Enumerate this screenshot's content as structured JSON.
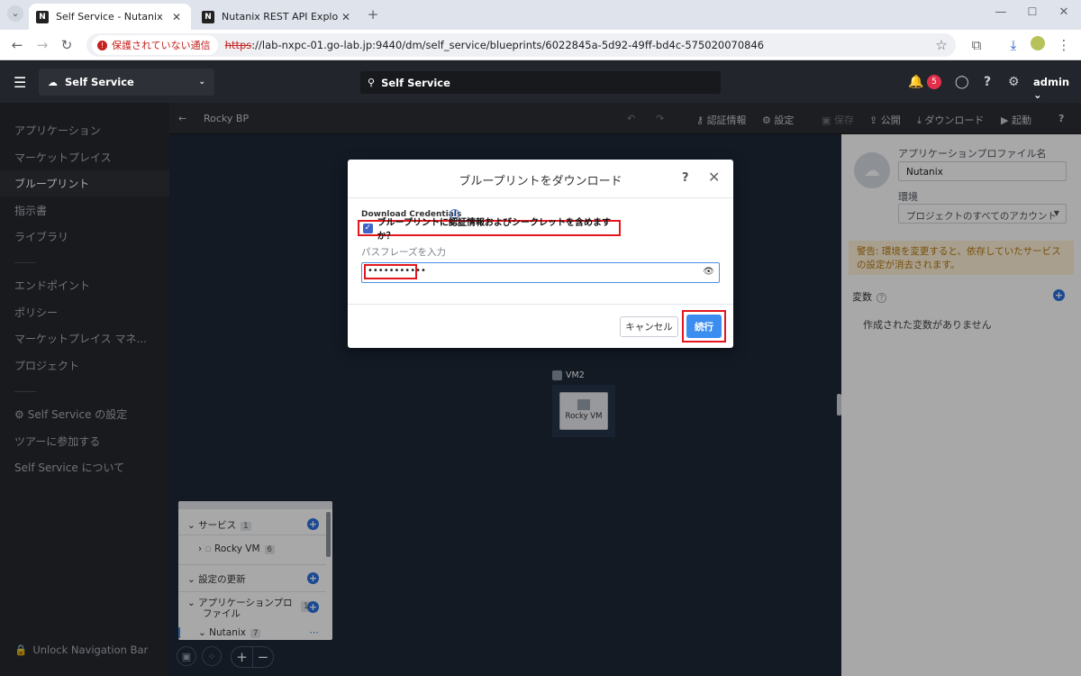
{
  "browser": {
    "tabs": [
      {
        "title": "Self Service - Nutanix",
        "icon": "N"
      },
      {
        "title": "Nutanix REST API Explorer",
        "icon": "N"
      }
    ],
    "security_label": "保護されていない通信",
    "url_scheme": "https",
    "url_rest": "://lab-nxpc-01.go-lab.jp:9440/dm/self_service/blueprints/6022845a-5d92-49ff-bd4c-575020070846"
  },
  "header": {
    "app_selector": "Self Service",
    "search_value": "Self Service",
    "notification_count": "5",
    "user": "admin"
  },
  "sidebar": {
    "items": [
      {
        "label": "アプリケーション"
      },
      {
        "label": "マーケットプレイス"
      },
      {
        "label": "ブループリント"
      },
      {
        "label": "指示書"
      },
      {
        "label": "ライブラリ"
      },
      {
        "label": "エンドポイント"
      },
      {
        "label": "ポリシー"
      },
      {
        "label": "マーケットプレイス マネ..."
      },
      {
        "label": "プロジェクト"
      },
      {
        "label": "Self Service の設定"
      },
      {
        "label": "ツアーに参加する"
      },
      {
        "label": "Self Service について"
      }
    ],
    "active_index": 2,
    "unlock_label": "Unlock Navigation Bar"
  },
  "toolbar": {
    "blueprint_name": "Rocky BP",
    "credentials": "認証情報",
    "settings": "設定",
    "save": "保存",
    "publish": "公開",
    "download": "ダウンロード",
    "launch": "起動",
    "help": "?"
  },
  "right_panel": {
    "profile_name_label": "アプリケーションプロファイル名",
    "profile_name_value": "Nutanix",
    "env_label": "環境",
    "env_value": "プロジェクトのすべてのアカウント",
    "warning_prefix": "警告:",
    "warning_text": " 環境を変更すると、依存していたサービスの設定が消去されます。",
    "variables_label": "変数",
    "no_variables": "作成された変数がありません"
  },
  "canvas": {
    "vm_group_label": "VM2",
    "vm_card_label": "Rocky VM"
  },
  "tree": {
    "services_label": "サービス",
    "services_count": "1",
    "rocky_vm_label": "Rocky VM",
    "rocky_vm_count": "6",
    "update_config_label": "設定の更新",
    "app_profile_label_1": "アプリケーションプロ",
    "app_profile_label_2": "ファイル",
    "app_profile_count": "1",
    "nutanix_label": "Nutanix",
    "nutanix_count": "7"
  },
  "modal": {
    "title": "ブループリントをダウンロード",
    "help": "?",
    "download_credentials_label": "Download Credentials",
    "checkbox_label": "ブループリントに認証情報およびシークレットを含めますか？",
    "checkbox_checked": true,
    "passphrase_label": "パスフレーズを入力",
    "passphrase_value": "•••••••••••",
    "cancel_label": "キャンセル",
    "continue_label": "続行"
  },
  "colors": {
    "accent": "#3b8df0",
    "highlight": "#e3161d",
    "badge": "#e2304b",
    "warning_bg": "#fff2d8"
  }
}
